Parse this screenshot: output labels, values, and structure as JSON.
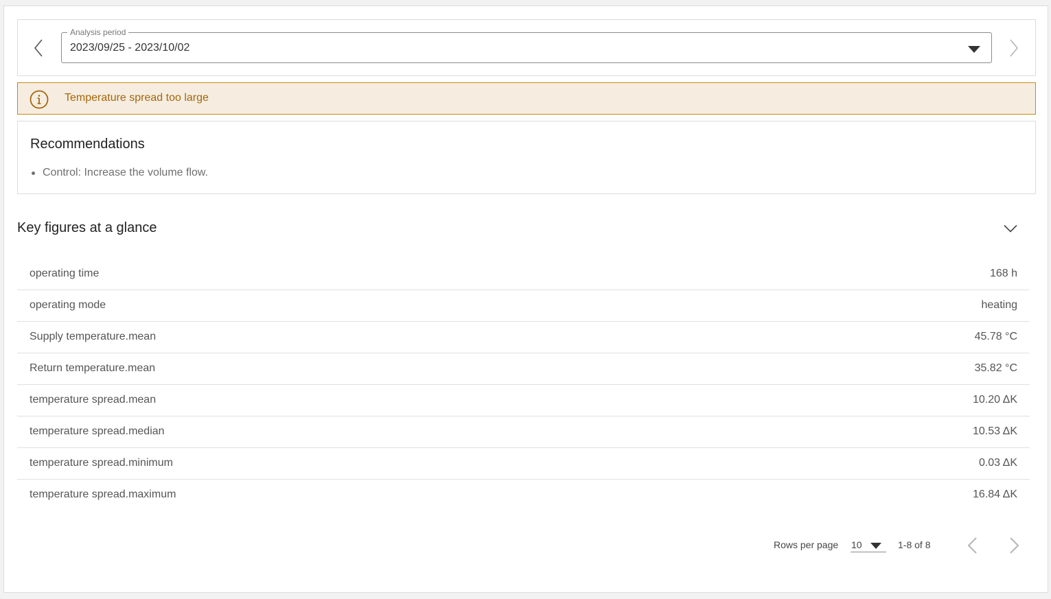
{
  "period": {
    "label": "Analysis period",
    "value": "2023/09/25 - 2023/10/02"
  },
  "alert": {
    "icon": "info-circle-icon",
    "text": "Temperature spread too large",
    "color": "#a5660b",
    "background": "#f6ede0"
  },
  "recommendations": {
    "title": "Recommendations",
    "items": [
      "Control: Increase the volume flow."
    ]
  },
  "key_figures": {
    "title": "Key figures at a glance",
    "expanded": true,
    "rows": [
      {
        "label": "operating time",
        "value": "168 h"
      },
      {
        "label": "operating mode",
        "value": "heating"
      },
      {
        "label": "Supply temperature.mean",
        "value": "45.78 °C"
      },
      {
        "label": "Return temperature.mean",
        "value": "35.82 °C"
      },
      {
        "label": "temperature spread.mean",
        "value": "10.20 ΔK"
      },
      {
        "label": "temperature spread.median",
        "value": "10.53 ΔK"
      },
      {
        "label": "temperature spread.minimum",
        "value": "0.03 ΔK"
      },
      {
        "label": "temperature spread.maximum",
        "value": "16.84 ΔK"
      }
    ]
  },
  "pagination": {
    "rows_per_page_label": "Rows per page",
    "rows_per_page": "10",
    "range": "1-8 of 8"
  }
}
